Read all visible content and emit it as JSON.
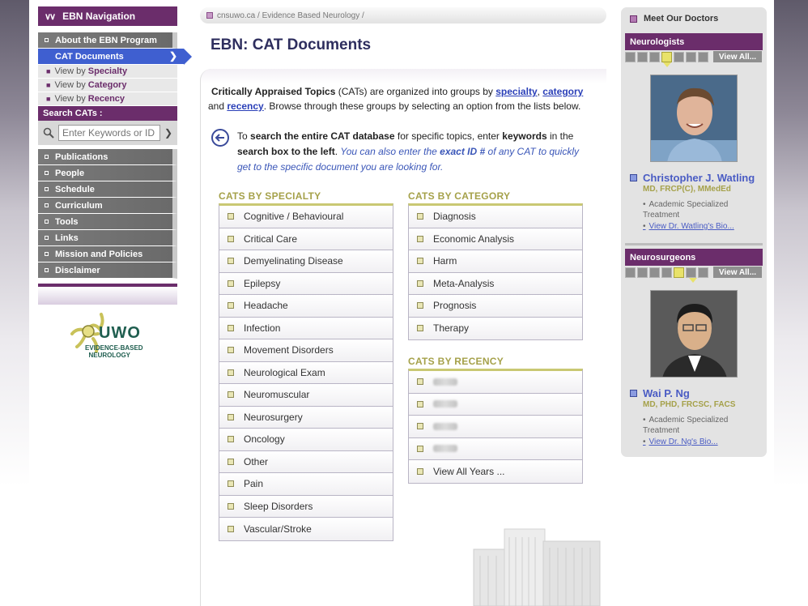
{
  "nav": {
    "header": "EBN Navigation",
    "items_top": [
      {
        "label": "About the EBN Program"
      }
    ],
    "active": {
      "label": "CAT Documents"
    },
    "sub": [
      {
        "prefix": "View by",
        "label": "Specialty"
      },
      {
        "prefix": "View by",
        "label": "Category"
      },
      {
        "prefix": "View by",
        "label": "Recency"
      }
    ],
    "search": {
      "title": "Search CATs :",
      "placeholder": "Enter Keywords or ID #"
    },
    "items_bottom": [
      {
        "label": "Publications"
      },
      {
        "label": "People"
      },
      {
        "label": "Schedule"
      },
      {
        "label": "Curriculum"
      },
      {
        "label": "Tools"
      },
      {
        "label": "Links"
      },
      {
        "label": "Mission and Policies"
      },
      {
        "label": "Disclaimer"
      }
    ],
    "logo": {
      "text": "UWO",
      "sub1": "EVIDENCE-BASED",
      "sub2": "NEUROLOGY"
    }
  },
  "breadcrumb": "cnsuwo.ca / Evidence Based Neurology /",
  "page_title": "EBN: CAT Documents",
  "intro": {
    "p1": "Critically Appraised Topics",
    "p2": " (CATs) are organized into groups by ",
    "link_specialty": "specialty",
    "comma": ", ",
    "link_category": "category",
    "and": " and ",
    "link_recency": "recency",
    "p3": ". Browse through these groups by selecting an option from the lists below."
  },
  "tip": {
    "t1": "To ",
    "b1": "search the entire CAT database",
    "t2": " for specific topics, enter ",
    "b2": "keywords",
    "t3": " in the ",
    "b3": "search box to the left",
    "t4": ". ",
    "i1": "You can also enter the ",
    "ib": "exact ID #",
    "i2": " of any CAT to quickly get to the specific document you are looking for."
  },
  "specialty": {
    "title": "CATS BY SPECIALTY",
    "items": [
      "Cognitive / Behavioural",
      "Critical Care",
      "Demyelinating Disease",
      "Epilepsy",
      "Headache",
      "Infection",
      "Movement Disorders",
      "Neurological Exam",
      "Neuromuscular",
      "Neurosurgery",
      "Oncology",
      "Other",
      "Pain",
      "Sleep Disorders",
      "Vascular/Stroke"
    ]
  },
  "category": {
    "title": "CATS BY CATEGORY",
    "items": [
      "Diagnosis",
      "Economic Analysis",
      "Harm",
      "Meta-Analysis",
      "Prognosis",
      "Therapy"
    ]
  },
  "recency": {
    "title": "CATS BY RECENCY",
    "view_all": "View All Years ..."
  },
  "doctors": {
    "title": "Meet Our Doctors",
    "view_all": "View All...",
    "neurologists": {
      "heading": "Neurologists",
      "name": "Christopher J. Watling",
      "cred": "MD, FRCP(C), MMedEd",
      "info": "Academic Specialized Treatment",
      "bio": "View Dr. Watling's Bio..."
    },
    "neurosurgeons": {
      "heading": "Neurosurgeons",
      "name": "Wai P. Ng",
      "cred": "MD, PHD, FRCSC, FACS",
      "info": "Academic Specialized Treatment",
      "bio": "View Dr. Ng's Bio..."
    }
  },
  "colors": {
    "brand_purple": "#6b2d6b",
    "active_blue": "#3f5fd0",
    "olive": "#a5a14a",
    "link_blue": "#2a3fb8"
  }
}
